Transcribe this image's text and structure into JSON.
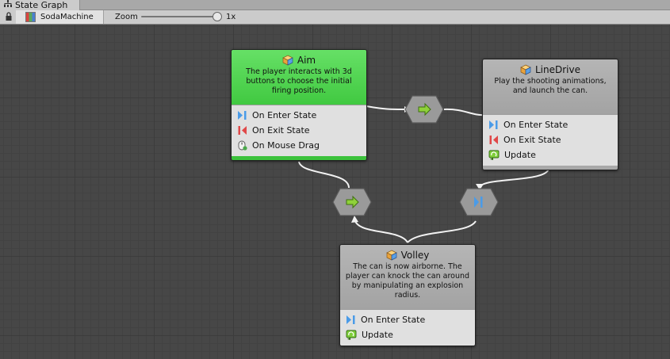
{
  "window": {
    "tab_title": "State Graph"
  },
  "toolbar": {
    "breadcrumb": "SodaMachine",
    "zoom_label": "Zoom",
    "zoom_value": "1x",
    "zoom_level": 1
  },
  "colors": {
    "canvas": "#474747",
    "start_state": "#41c941",
    "state_header": "#a8a8a8",
    "edge": "#f2f2f2"
  },
  "states": [
    {
      "title": "Aim",
      "description": "The player interacts with 3d buttons to choose the initial firing position.",
      "is_start": true,
      "events": [
        {
          "label": "On Enter State",
          "icon": "enter-state-icon"
        },
        {
          "label": "On Exit State",
          "icon": "exit-state-icon"
        },
        {
          "label": "On Mouse Drag",
          "icon": "mouse-drag-icon"
        }
      ]
    },
    {
      "title": "LineDrive",
      "description": "Play the shooting animations, and launch the can.",
      "is_start": false,
      "events": [
        {
          "label": "On Enter State",
          "icon": "enter-state-icon"
        },
        {
          "label": "On Exit State",
          "icon": "exit-state-icon"
        },
        {
          "label": "Update",
          "icon": "update-icon"
        }
      ]
    },
    {
      "title": "Volley",
      "description": "The can is now airborne. The player can knock the can around by manipulating an explosion radius.",
      "is_start": false,
      "events": [
        {
          "label": "On Enter State",
          "icon": "enter-state-icon"
        },
        {
          "label": "Update",
          "icon": "update-icon"
        }
      ]
    }
  ],
  "transitions": [
    {
      "from": "Aim",
      "to": "LineDrive",
      "icon": "arrow-right-icon"
    },
    {
      "from": "Aim",
      "to": "Volley",
      "icon": "arrow-right-icon"
    },
    {
      "from": "LineDrive",
      "to": "Volley",
      "icon": "enter-state-icon"
    }
  ]
}
